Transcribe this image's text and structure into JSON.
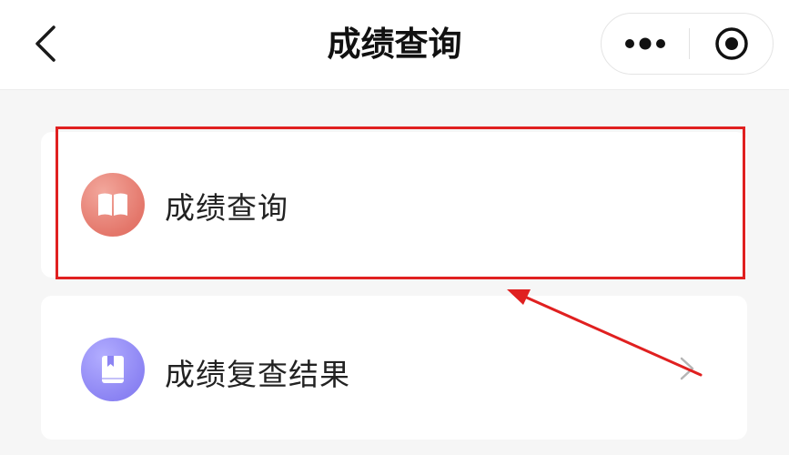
{
  "header": {
    "title": "成绩查询",
    "back_icon": "chevron-left-icon",
    "more_icon": "more-dots-icon",
    "close_icon": "target-circle-icon"
  },
  "menu": {
    "items": [
      {
        "label": "成绩查询",
        "icon": "open-book-icon",
        "icon_color": "#e4776b",
        "highlighted": true
      },
      {
        "label": "成绩复查结果",
        "icon": "bookmark-book-icon",
        "icon_color": "#8c84f3",
        "has_chevron": true
      }
    ]
  },
  "annotation": {
    "color": "#e02020"
  }
}
